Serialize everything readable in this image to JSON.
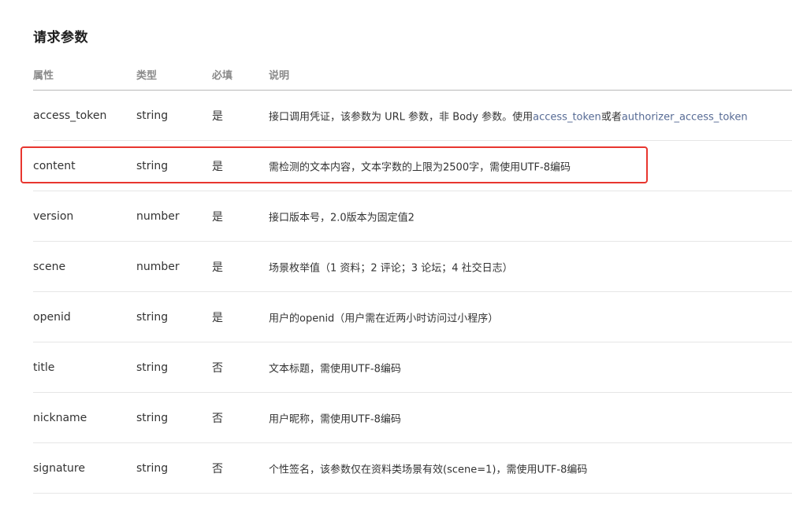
{
  "section_title": "请求参数",
  "columns": {
    "name": "属性",
    "type": "类型",
    "required": "必填",
    "description": "说明"
  },
  "rows": [
    {
      "name": "access_token",
      "type": "string",
      "required": "是",
      "desc_prefix": "接口调用凭证，该参数为 URL 参数，非 Body 参数。使用",
      "desc_link1": "access_token",
      "desc_mid": "或者",
      "desc_link2": "authorizer_access_token"
    },
    {
      "name": "content",
      "type": "string",
      "required": "是",
      "description": "需检测的文本内容，文本字数的上限为2500字，需使用UTF-8编码"
    },
    {
      "name": "version",
      "type": "number",
      "required": "是",
      "description": "接口版本号，2.0版本为固定值2"
    },
    {
      "name": "scene",
      "type": "number",
      "required": "是",
      "description": "场景枚举值（1 资料；2 评论；3 论坛；4 社交日志）"
    },
    {
      "name": "openid",
      "type": "string",
      "required": "是",
      "description": "用户的openid（用户需在近两小时访问过小程序）"
    },
    {
      "name": "title",
      "type": "string",
      "required": "否",
      "description": "文本标题，需使用UTF-8编码"
    },
    {
      "name": "nickname",
      "type": "string",
      "required": "否",
      "description": "用户昵称，需使用UTF-8编码"
    },
    {
      "name": "signature",
      "type": "string",
      "required": "否",
      "description": "个性签名，该参数仅在资料类场景有效(scene=1)，需使用UTF-8编码"
    }
  ],
  "colors": {
    "link": "#576b95",
    "highlight": "#e8362f"
  }
}
